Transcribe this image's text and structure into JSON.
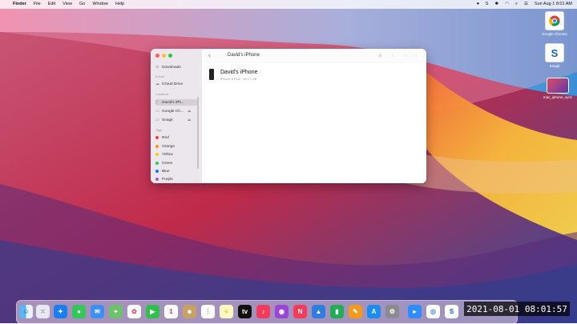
{
  "menubar": {
    "apple_glyph": "",
    "app": "Finder",
    "items": [
      "File",
      "Edit",
      "View",
      "Go",
      "Window",
      "Help"
    ],
    "clock": "Sun Aug 1  8:01 AM"
  },
  "desktop": {
    "icons": [
      {
        "label": "Google Chrome",
        "icon": "chrome-icon"
      },
      {
        "label": "Snagit",
        "icon": "snagit-icon"
      },
      {
        "label": "mac_iphone_sync",
        "icon": "image-file-icon"
      }
    ]
  },
  "finder": {
    "title": "David's iPhone",
    "sidebar": {
      "downloads": "Downloads",
      "icloud_header": "iCloud",
      "icloud_drive": "iCloud Drive",
      "locations_header": "Locations",
      "locations": [
        "David's iPh...",
        "Google Ch...",
        "Snagit"
      ],
      "tags_header": "Tags",
      "tags": [
        {
          "label": "Red",
          "color": "#ff3b30"
        },
        {
          "label": "Orange",
          "color": "#ff9500"
        },
        {
          "label": "Yellow",
          "color": "#ffcc00"
        },
        {
          "label": "Green",
          "color": "#34c759"
        },
        {
          "label": "Blue",
          "color": "#007aff"
        },
        {
          "label": "Purple",
          "color": "#af52de"
        }
      ]
    },
    "device": {
      "name": "David's iPhone",
      "info": "iPhone 6 Plus · 59.17 GB"
    }
  },
  "dock": {
    "apps": [
      "finder-icon",
      "launchpad-icon",
      "safari-icon",
      "messages-icon",
      "mail-icon",
      "maps-icon",
      "photos-icon",
      "facetime-icon",
      "calendar-icon",
      "contacts-icon",
      "reminders-icon",
      "notes-icon",
      "appletv-icon",
      "music-icon",
      "podcasts-icon",
      "news-icon",
      "keynote-icon",
      "numbers-icon",
      "pages-icon",
      "appstore-icon",
      "systemprefs-icon",
      "zoom-icon",
      "chrome-icon",
      "snagit-icon"
    ]
  },
  "timestamp": "2021-08-01  08:01:57"
}
